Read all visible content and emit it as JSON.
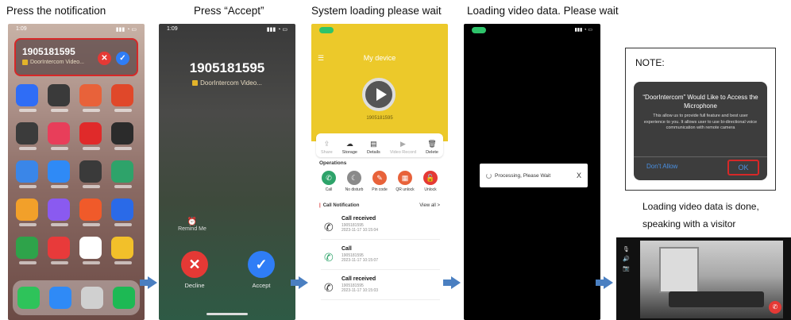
{
  "steps": {
    "s1": "Press the notification",
    "s2": "Press “Accept”",
    "s3": "System loading please wait",
    "s4": "Loading video data. Please wait",
    "s6_line1": "Loading video data is done,",
    "s6_line2": "speaking with a visitor"
  },
  "phone1": {
    "time": "1:09",
    "notification_number": "1905181595",
    "notification_app": "DoorIntercom Video...",
    "app_colors": [
      "#2f6df6",
      "#3a3a3a",
      "#e8623a",
      "#e0482a",
      "#3b3b3b",
      "#e83e5a",
      "#e02a2a",
      "#2b2b2b",
      "#3a86e8",
      "#2f8af6",
      "#3a3a3a",
      "#2ea36a",
      "#f2a02a",
      "#8a5af0",
      "#f05a2a",
      "#2a6ae8",
      "#2ea34a",
      "#e83a3a",
      "#ffffff",
      "#f2c02a"
    ],
    "dock_colors": [
      "#2ec35a",
      "#2f8af6",
      "#d0d0d0",
      "#1db954"
    ]
  },
  "phone2": {
    "time": "1:09",
    "caller": "1905181595",
    "app": "DoorIntercom Video...",
    "remind": "Remind Me",
    "decline": "Decline",
    "accept": "Accept"
  },
  "phone3": {
    "title": "My device",
    "device_id": "1905181595",
    "icons": [
      {
        "label": "Share",
        "icon": "share-icon",
        "dim": true
      },
      {
        "label": "Storage",
        "icon": "storage-icon",
        "dim": false
      },
      {
        "label": "Details",
        "icon": "details-icon",
        "dim": false
      },
      {
        "label": "Video Record",
        "icon": "video-record-icon",
        "dim": true
      },
      {
        "label": "Delete",
        "icon": "delete-icon",
        "dim": false
      }
    ],
    "operations_title": "Operations",
    "operations": [
      {
        "label": "Call",
        "color": "#2ea36a",
        "glyph": "✆"
      },
      {
        "label": "No disturb",
        "color": "#8a8a8a",
        "glyph": "☾"
      },
      {
        "label": "Pin code",
        "color": "#e8623a",
        "glyph": "✎"
      },
      {
        "label": "QR unlock",
        "color": "#e8623a",
        "glyph": "▦"
      },
      {
        "label": "Unlock",
        "color": "#e53935",
        "glyph": "🔓"
      }
    ],
    "call_notification": "Call Notification",
    "view_all": "View all >",
    "calls": [
      {
        "title": "Call received",
        "id": "1905181595",
        "time": "2023-11-17 10:15:04"
      },
      {
        "title": "Call",
        "id": "1905181595",
        "time": "2023-11-17 10:15:07"
      },
      {
        "title": "Call received",
        "id": "1905181595",
        "time": "2023-11-17 10:15:03"
      }
    ]
  },
  "phone4": {
    "processing": "Processing, Please Wait",
    "close": "X"
  },
  "note": {
    "title": "NOTE:",
    "dialog_title": "“DoorIntercom” Would Like to Access the Microphone",
    "dialog_body": "This allow us to provide full feature and best user experience to you. It allows user to use bi-directional voice communication with remote camera",
    "dont_allow": "Don't Allow",
    "ok": "OK"
  }
}
